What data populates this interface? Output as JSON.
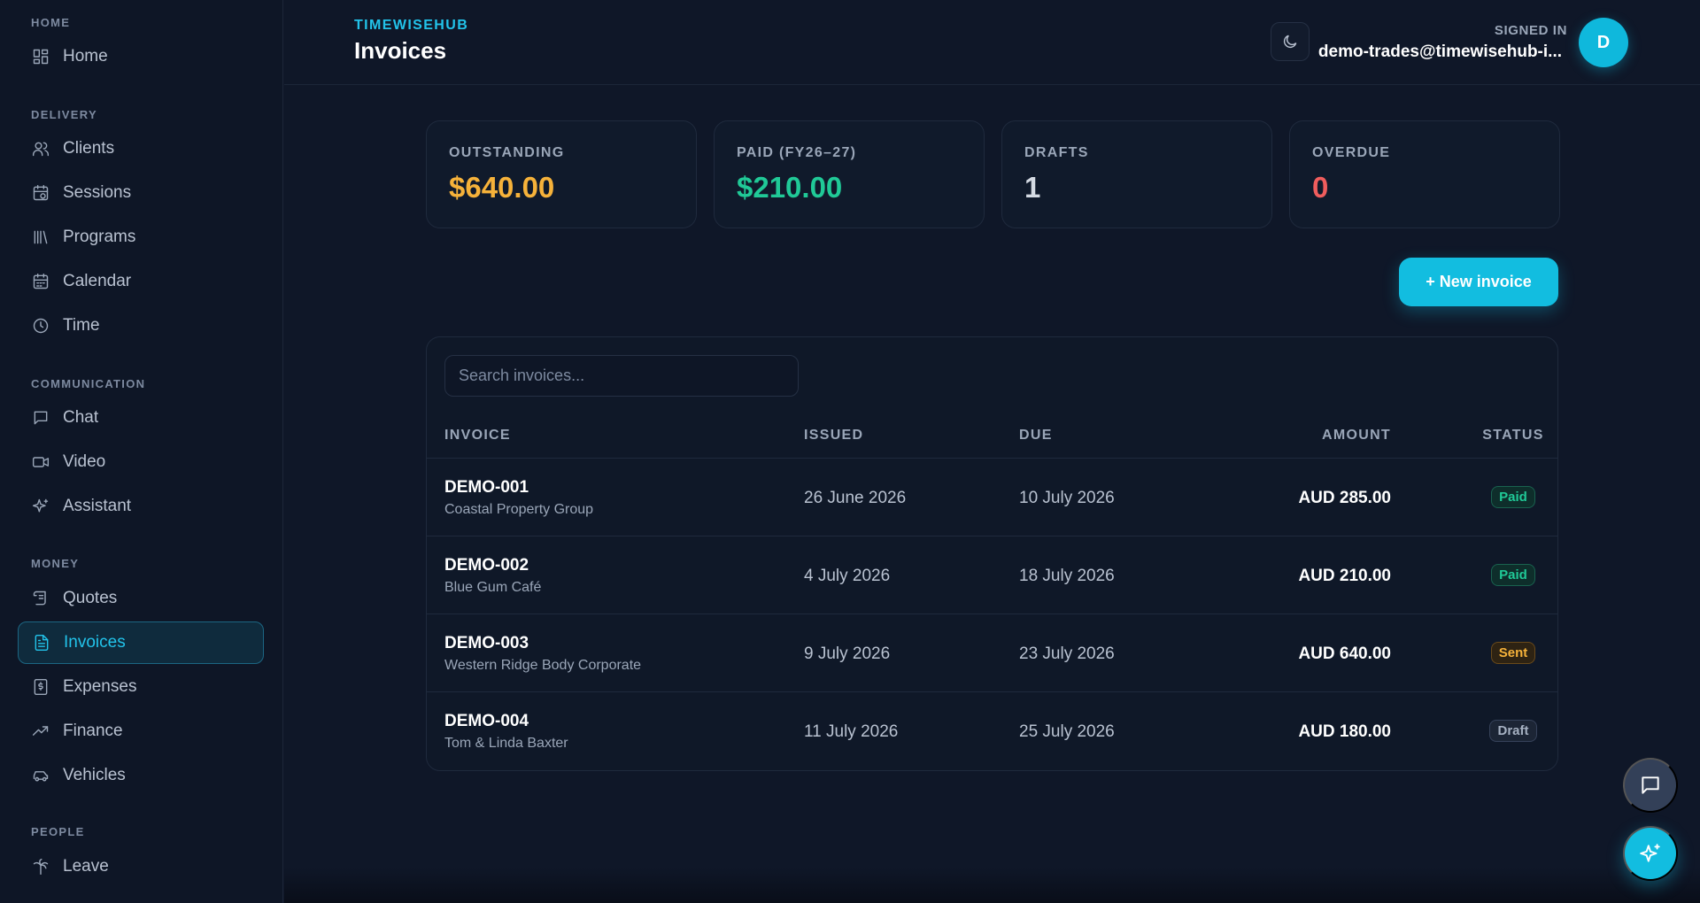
{
  "sidebar": {
    "sections": [
      {
        "label": "HOME"
      },
      {
        "label": "DELIVERY"
      },
      {
        "label": "COMMUNICATION"
      },
      {
        "label": "MONEY"
      },
      {
        "label": "PEOPLE"
      }
    ],
    "items": [
      {
        "label": "Home",
        "icon": "grid-icon"
      },
      {
        "label": "Clients",
        "icon": "users-icon"
      },
      {
        "label": "Sessions",
        "icon": "calendar-clock-icon"
      },
      {
        "label": "Programs",
        "icon": "library-icon"
      },
      {
        "label": "Calendar",
        "icon": "calendar-icon"
      },
      {
        "label": "Time",
        "icon": "clock-icon"
      },
      {
        "label": "Chat",
        "icon": "message-square-icon"
      },
      {
        "label": "Video",
        "icon": "video-icon"
      },
      {
        "label": "Assistant",
        "icon": "sparkles-icon"
      },
      {
        "label": "Quotes",
        "icon": "scroll-icon"
      },
      {
        "label": "Invoices",
        "icon": "file-text-icon",
        "active": true
      },
      {
        "label": "Expenses",
        "icon": "receipt-dollar-icon"
      },
      {
        "label": "Finance",
        "icon": "trending-up-icon"
      },
      {
        "label": "Vehicles",
        "icon": "car-icon"
      },
      {
        "label": "Leave",
        "icon": "palm-tree-icon"
      }
    ]
  },
  "header": {
    "brand": "TIMEWISEHUB",
    "title": "Invoices",
    "signed_in_label": "SIGNED IN",
    "user_email": "demo-trades@timewisehub-i...",
    "avatar_initial": "D",
    "theme_icon": "moon-icon"
  },
  "stats": [
    {
      "label": "OUTSTANDING",
      "value": "$640.00",
      "color": "#f6b23a"
    },
    {
      "label": "PAID (FY26–27)",
      "value": "$210.00",
      "color": "#20c997"
    },
    {
      "label": "DRAFTS",
      "value": "1",
      "color": "#d4dae3"
    },
    {
      "label": "OVERDUE",
      "value": "0",
      "color": "#f05d5d"
    }
  ],
  "actions": {
    "new_invoice": "+ New invoice"
  },
  "table": {
    "search_placeholder": "Search invoices...",
    "columns": {
      "invoice": "INVOICE",
      "issued": "ISSUED",
      "due": "DUE",
      "amount": "AMOUNT",
      "status": "STATUS"
    },
    "rows": [
      {
        "id": "DEMO-001",
        "client": "Coastal Property Group",
        "issued": "26 June 2026",
        "due": "10 July 2026",
        "amount": "AUD 285.00",
        "status": "Paid"
      },
      {
        "id": "DEMO-002",
        "client": "Blue Gum Café",
        "issued": "4 July 2026",
        "due": "18 July 2026",
        "amount": "AUD 210.00",
        "status": "Paid"
      },
      {
        "id": "DEMO-003",
        "client": "Western Ridge Body Corporate",
        "issued": "9 July 2026",
        "due": "23 July 2026",
        "amount": "AUD 640.00",
        "status": "Sent"
      },
      {
        "id": "DEMO-004",
        "client": "Tom & Linda Baxter",
        "issued": "11 July 2026",
        "due": "25 July 2026",
        "amount": "AUD 180.00",
        "status": "Draft"
      }
    ]
  },
  "floating": {
    "chat_icon": "message-square-icon",
    "assistant_icon": "sparkles-icon"
  },
  "colors": {
    "accent": "#12bde0",
    "background": "#0f1728"
  }
}
